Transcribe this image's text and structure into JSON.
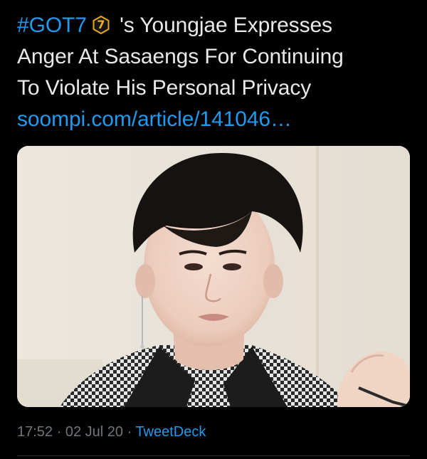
{
  "tweet": {
    "hashtag": "#GOT7",
    "emoji": {
      "name": "got7-badge-icon",
      "label": "7",
      "color": "#f2b01e"
    },
    "text_line1": " 's Youngjae Expresses",
    "text_line2": "Anger At Sasaengs For Continuing",
    "text_line3": "To Violate His Personal Privacy",
    "link": "soompi.com/article/141046…"
  },
  "meta": {
    "time": "17:52",
    "sep1": " · ",
    "date": "02 Jul 20",
    "sep2": " · ",
    "client": "TweetDeck"
  },
  "colors": {
    "background": "#000000",
    "text": "#e7e9ea",
    "link": "#1d9bf0",
    "muted": "#71767b"
  }
}
